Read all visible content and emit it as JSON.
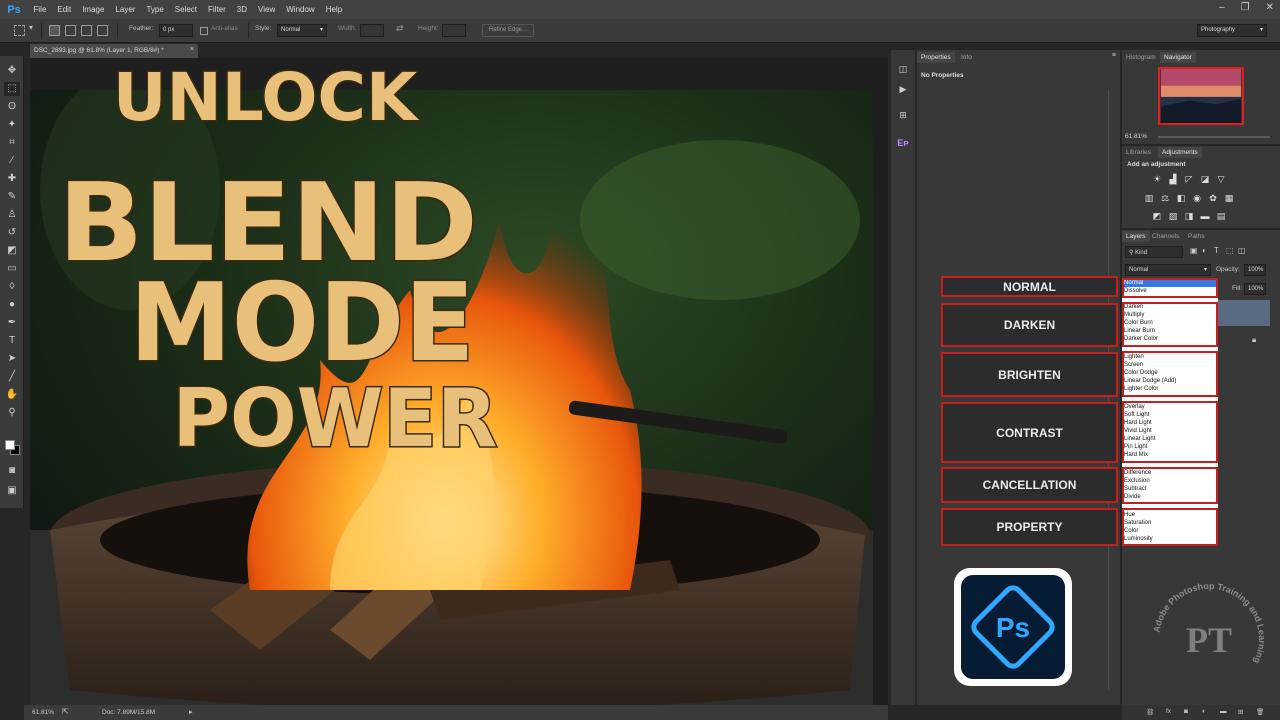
{
  "app": {
    "logo": "Ps",
    "window_controls": [
      "–",
      "❐",
      "✕"
    ]
  },
  "menu": [
    "File",
    "Edit",
    "Image",
    "Layer",
    "Type",
    "Select",
    "Filter",
    "3D",
    "View",
    "Window",
    "Help"
  ],
  "options_bar": {
    "feather_label": "Feather:",
    "feather_value": "0 px",
    "anti_alias_label": "Anti-alias",
    "style_label": "Style:",
    "style_value": "Normal",
    "width_label": "Width:",
    "height_label": "Height:",
    "refine_edge_label": "Refine Edge...",
    "workspace_value": "Photography"
  },
  "document": {
    "tab_title": "DSC_2893.jpg @ 61.8% (Layer 1, RGB/8#) *",
    "close_glyph": "×"
  },
  "artwork": {
    "line1": "UNLOCK",
    "line2": "BLEND",
    "line3": "MODE",
    "line4": "POWER"
  },
  "status_bar": {
    "zoom": "61.81%",
    "doc_info": "Doc: 7.89M/15.8M"
  },
  "properties_panel": {
    "tabs": [
      "Properties",
      "Info"
    ],
    "message": "No Properties"
  },
  "navigator_panel": {
    "tabs": [
      "Histogram",
      "Navigator"
    ],
    "zoom": "61.81%"
  },
  "adjustments_panel": {
    "tabs": [
      "Libraries",
      "Adjustments"
    ],
    "header": "Add an adjustment"
  },
  "layers_panel": {
    "tabs": [
      "Layers",
      "Channels",
      "Paths"
    ],
    "kind_filter": "Kind",
    "blend_mode": "Normal",
    "opacity_label": "Opacity:",
    "opacity_value": "100%",
    "fill_label": "Fill:",
    "fill_value": "100%",
    "bottom_icons": [
      "link-icon",
      "fx-icon",
      "mask-icon",
      "adjustment-icon",
      "folder-icon",
      "new-layer-icon",
      "trash-icon"
    ]
  },
  "blend_groups": [
    {
      "category": "NORMAL",
      "modes": [
        "Normal",
        "Dissolve"
      ]
    },
    {
      "category": "DARKEN",
      "modes": [
        "Darken",
        "Multiply",
        "Color Burn",
        "Linear Burn",
        "Darker Color"
      ]
    },
    {
      "category": "BRIGHTEN",
      "modes": [
        "Lighten",
        "Screen",
        "Color Dodge",
        "Linear Dodge (Add)",
        "Lighter Color"
      ]
    },
    {
      "category": "CONTRAST",
      "modes": [
        "Overlay",
        "Soft Light",
        "Hard Light",
        "Vivid Light",
        "Linear Light",
        "Pin Light",
        "Hard Mix"
      ]
    },
    {
      "category": "CANCELLATION",
      "modes": [
        "Difference",
        "Exclusion",
        "Subtract",
        "Divide"
      ]
    },
    {
      "category": "PROPERTY",
      "modes": [
        "Hue",
        "Saturation",
        "Color",
        "Luminosity"
      ]
    }
  ],
  "logos": {
    "ps_badge": "Ps",
    "watermark_text": "Adobe Photoshop Training and Learning",
    "watermark_mark": "PT"
  },
  "colors": {
    "highlight_red": "#c81e1e",
    "selection_blue": "#3478e0",
    "ps_blue": "#31a8ff"
  }
}
